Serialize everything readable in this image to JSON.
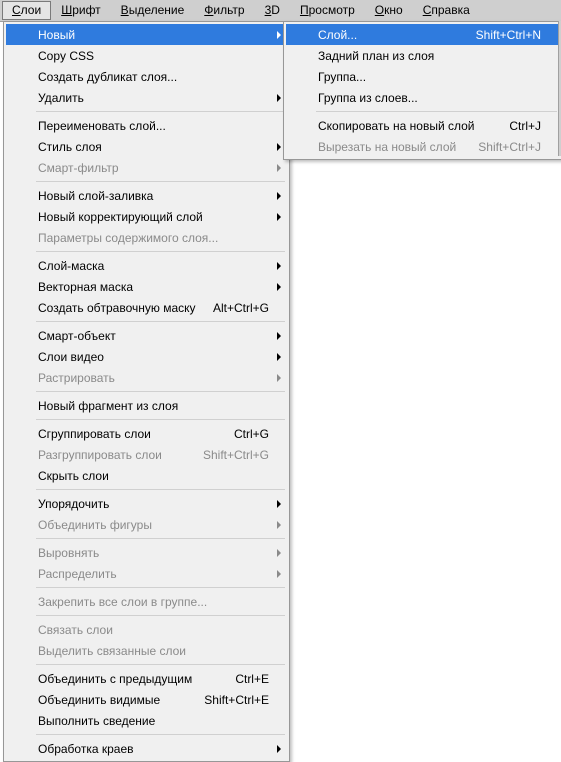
{
  "menubar": {
    "items": [
      {
        "label": "Слои",
        "m": "С"
      },
      {
        "label": "Шрифт",
        "m": "Ш"
      },
      {
        "label": "Выделение",
        "m": "В"
      },
      {
        "label": "Фильтр",
        "m": "Ф"
      },
      {
        "label": "3D",
        "m": "3"
      },
      {
        "label": "Просмотр",
        "m": "П"
      },
      {
        "label": "Окно",
        "m": "О"
      },
      {
        "label": "Справка",
        "m": "С"
      }
    ]
  },
  "dropdown": {
    "groups": [
      [
        {
          "label": "Новый",
          "submenu": true,
          "highlight": true
        },
        {
          "label": "Copy CSS"
        },
        {
          "label": "Создать дубликат слоя..."
        },
        {
          "label": "Удалить",
          "submenu": true
        }
      ],
      [
        {
          "label": "Переименовать слой..."
        },
        {
          "label": "Стиль слоя",
          "submenu": true
        },
        {
          "label": "Смарт-фильтр",
          "submenu": true,
          "disabled": true
        }
      ],
      [
        {
          "label": "Новый слой-заливка",
          "submenu": true
        },
        {
          "label": "Новый корректирующий слой",
          "submenu": true
        },
        {
          "label": "Параметры содержимого слоя...",
          "disabled": true
        }
      ],
      [
        {
          "label": "Слой-маска",
          "submenu": true
        },
        {
          "label": "Векторная маска",
          "submenu": true
        },
        {
          "label": "Создать обтравочную маску",
          "shortcut": "Alt+Ctrl+G"
        }
      ],
      [
        {
          "label": "Смарт-объект",
          "submenu": true
        },
        {
          "label": "Слои видео",
          "submenu": true
        },
        {
          "label": "Растрировать",
          "submenu": true,
          "disabled": true
        }
      ],
      [
        {
          "label": "Новый фрагмент из слоя"
        }
      ],
      [
        {
          "label": "Сгруппировать слои",
          "shortcut": "Ctrl+G"
        },
        {
          "label": "Разгруппировать слои",
          "shortcut": "Shift+Ctrl+G",
          "disabled": true
        },
        {
          "label": "Скрыть слои"
        }
      ],
      [
        {
          "label": "Упорядочить",
          "submenu": true
        },
        {
          "label": "Объединить фигуры",
          "submenu": true,
          "disabled": true
        }
      ],
      [
        {
          "label": "Выровнять",
          "submenu": true,
          "disabled": true
        },
        {
          "label": "Распределить",
          "submenu": true,
          "disabled": true
        }
      ],
      [
        {
          "label": "Закрепить все слои в группе...",
          "disabled": true
        }
      ],
      [
        {
          "label": "Связать слои",
          "disabled": true
        },
        {
          "label": "Выделить связанные слои",
          "disabled": true
        }
      ],
      [
        {
          "label": "Объединить с предыдущим",
          "shortcut": "Ctrl+E"
        },
        {
          "label": "Объединить видимые",
          "shortcut": "Shift+Ctrl+E"
        },
        {
          "label": "Выполнить сведение"
        }
      ],
      [
        {
          "label": "Обработка краев",
          "submenu": true
        }
      ]
    ]
  },
  "submenu": {
    "groups": [
      [
        {
          "label": "Слой...",
          "shortcut": "Shift+Ctrl+N",
          "highlight": true
        },
        {
          "label": "Задний план из слоя"
        },
        {
          "label": "Группа..."
        },
        {
          "label": "Группа из слоев..."
        }
      ],
      [
        {
          "label": "Скопировать на новый слой",
          "shortcut": "Ctrl+J"
        },
        {
          "label": "Вырезать на новый слой",
          "shortcut": "Shift+Ctrl+J",
          "disabled": true
        }
      ]
    ]
  }
}
